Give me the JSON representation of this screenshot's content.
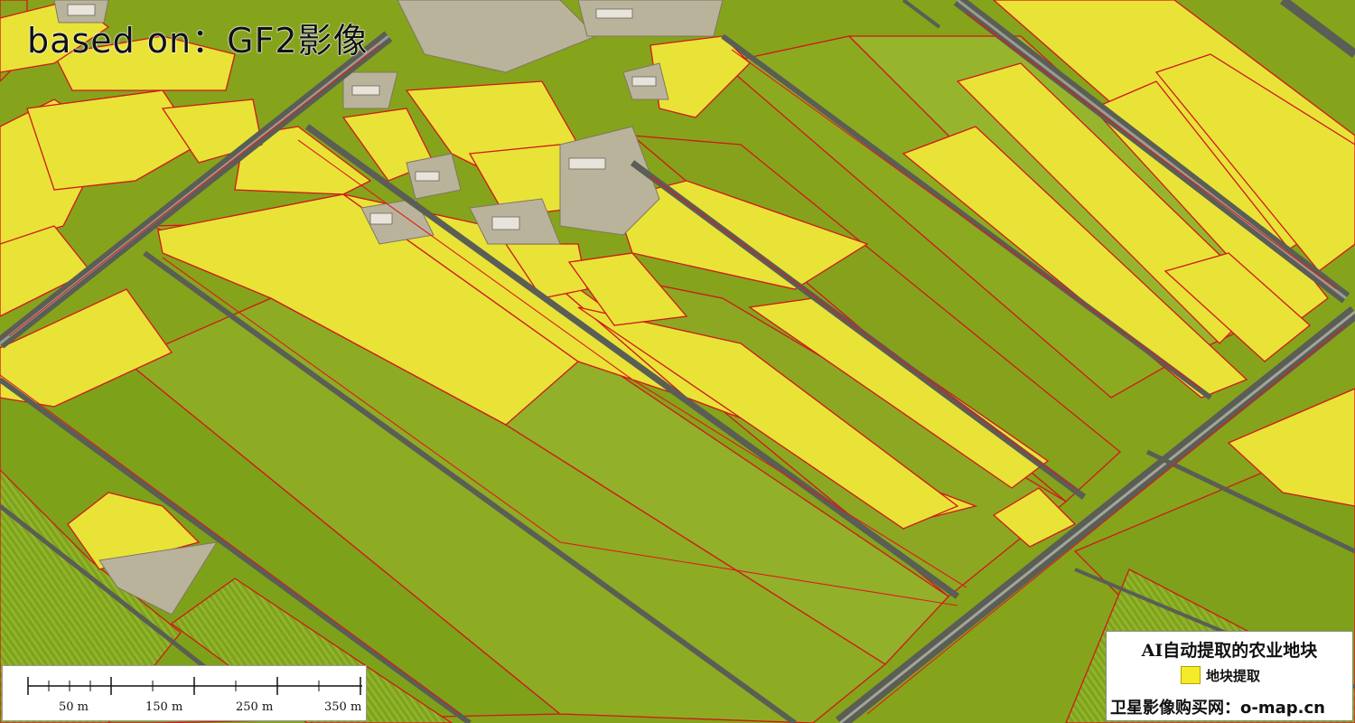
{
  "map": {
    "title": "based on：GF2影像"
  },
  "scale_bar": {
    "unit": "m",
    "labels": [
      "50 m",
      "150 m",
      "250 m",
      "350 m"
    ]
  },
  "legend": {
    "title": "AI自动提取的农业地块",
    "items": [
      {
        "label": "地块提取",
        "color": "#f2ec2a"
      }
    ],
    "footer": "卫星影像购买网：o-map.cn"
  },
  "colors": {
    "field_green": "#8aa51d",
    "field_yellow": "#e9e338",
    "parcel_outline": "#e01b1b",
    "road": "#5a5e55",
    "village": "#b8b09a"
  }
}
